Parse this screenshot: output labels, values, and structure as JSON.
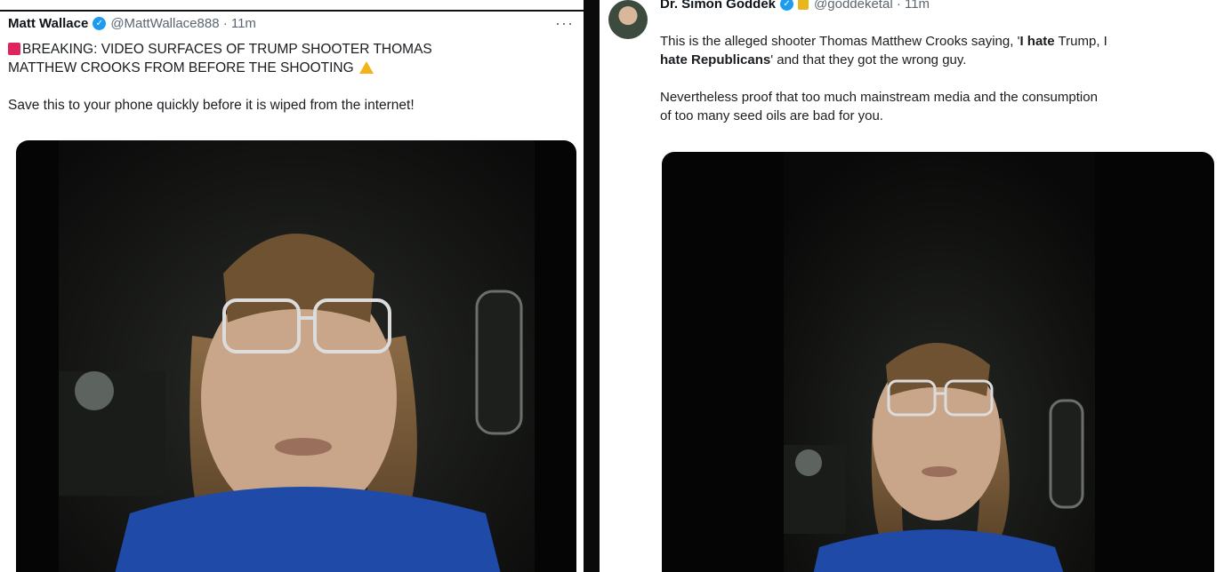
{
  "left_tweet": {
    "author_name": "Matt Wallace",
    "handle_time": "@MattWallace888 · 11m",
    "more": "···",
    "line1": "BREAKING: VIDEO SURFACES OF TRUMP SHOOTER THOMAS",
    "line2": "MATTHEW CROOKS FROM BEFORE THE SHOOTING",
    "body": "Save this to your phone quickly before it is wiped from the internet!"
  },
  "right_tweet": {
    "author_name": "Dr. Simon Goddek",
    "handle_time": "@goddeketal · 11m",
    "line1_a": "This is the alleged shooter Thomas Matthew Crooks saying, '",
    "line1_b": "I hate",
    "line1_c": " Trump, I",
    "line2_a": "hate Republicans",
    "line2_b": "' and that they got the wrong guy.",
    "para2_line1": "Nevertheless proof that too much mainstream media and the consumption",
    "para2_line2": "of too many seed oils are bad for you."
  },
  "colors": {
    "verified": "#1d9bf0",
    "text": "#1a1d20",
    "meta": "#5b6670",
    "shirt": "#1f4aa8"
  },
  "icons": [
    "verified-badge-icon",
    "breaking-emoji-icon",
    "warning-emoji-icon",
    "gold-badge-icon",
    "more-options-icon"
  ]
}
